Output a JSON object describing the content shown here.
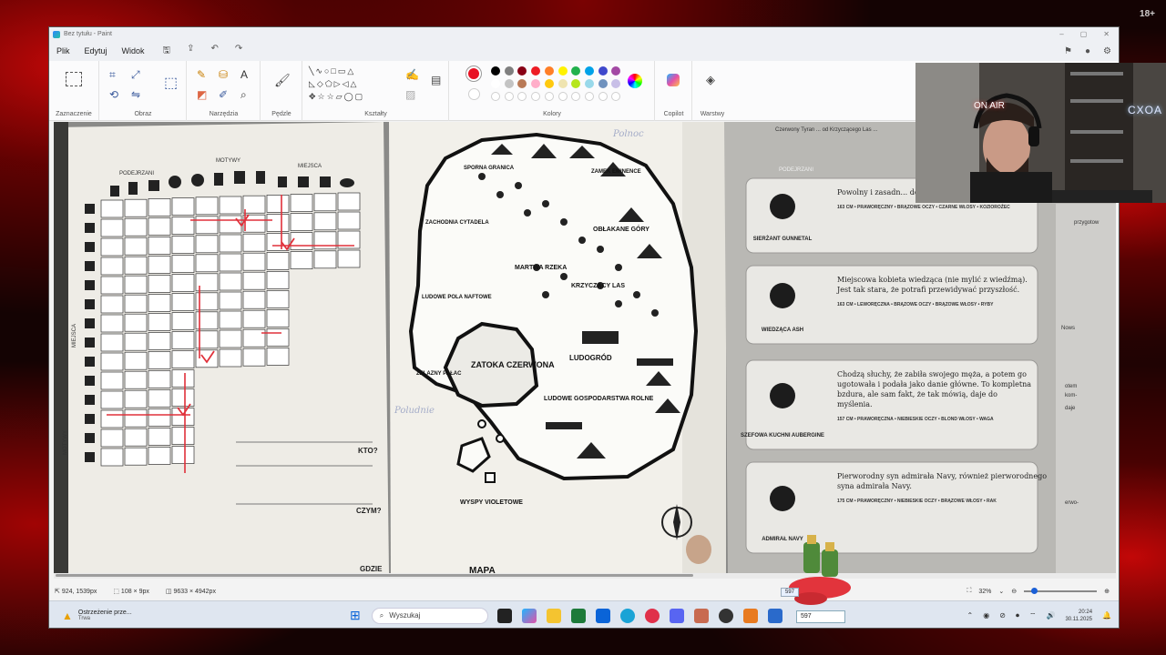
{
  "window": {
    "title": "Bez tytułu - Paint",
    "controls": [
      "–",
      "▢",
      "✕"
    ]
  },
  "menu": {
    "file": "Plik",
    "edit": "Edytuj",
    "view": "Widok"
  },
  "ribbon": {
    "groups": {
      "selection": "Zaznaczenie",
      "image": "Obraz",
      "tools": "Narzędzia",
      "brushes": "Pędzle",
      "shapes": "Kształty",
      "colors": "Kolory",
      "copilot": "Copilot",
      "layers": "Warstwy"
    },
    "palette_row1": [
      "#000000",
      "#7f7f7f",
      "#880015",
      "#ed1c24",
      "#ff7f27",
      "#fff200",
      "#22b14c",
      "#00a2e8",
      "#3f48cc",
      "#a349a4"
    ],
    "palette_row2": [
      "#ffffff",
      "#c3c3c3",
      "#b97a57",
      "#ffaec9",
      "#ffc90e",
      "#efe4b0",
      "#b5e61d",
      "#99d9ea",
      "#7092be",
      "#c8bfe7"
    ],
    "active_color": "#e81123"
  },
  "canvas": {
    "left_page": {
      "col_headers": [
        "PODEJRZANI",
        "MOTYWY",
        "MIEJSCA"
      ],
      "side_labels": [
        "MIEJSCA",
        "MOTYWY"
      ],
      "prompts": [
        "KTO?",
        "CZYM?",
        "GDZIE"
      ]
    },
    "map": {
      "handwritten_top": "Polnoc",
      "handwritten_left": "Poludnie",
      "places": [
        "SPORNA GRANICA",
        "ZAMEK EMINENCE",
        "ZACHODNIA CYTADELA",
        "OBŁAKANE GÓRY",
        "MARTWA RZEKA",
        "LUDOWE POLA NAFTOWE",
        "KRZYCZĄCY LAS",
        "ZATOKA CZERWONA",
        "LUDOGRÓD",
        "ŻELAZNY PAŁAC",
        "LUDOWE GOSPODARSTWA ROLNE",
        "WYSPY VIOLETOWE",
        "MAPA"
      ]
    },
    "right_page": {
      "top_text": "Czerwony Tyran ... od Krzyczącego Las ...",
      "section_title": "PODEJRZANI",
      "cards": [
        {
          "name": "SIERŻANT GUNNETAL",
          "desc": "Powolny i zasadn... do wiadomości show...",
          "traits": "163 CM • PRAWORĘCZNY • BRĄZOWE OCZY • CZARNE WŁOSY • KOZIOROŻEC"
        },
        {
          "name": "WIEDZĄCA ASH",
          "desc": "Miejscowa kobieta wiedząca (nie mylić z wiedźmą). Jest tak stara, że potrafi przewidywać przyszłość.",
          "traits": "163 CM • LEWORĘCZNA • BRĄZOWE OCZY • BRĄZOWE WŁOSY • RYBY"
        },
        {
          "name": "SZEFOWA KUCHNI AUBERGINE",
          "desc": "Chodzą słuchy, że zabiła swojego męża, a potem go ugotowała i podała jako danie główne. To kompletna bzdura, ale sam fakt, że tak mówią, daje do myślenia.",
          "traits": "157 CM • PRAWORĘCZNA • NIEBIESKIE OCZY • BLOND WŁOSY • WAGA"
        },
        {
          "name": "ADMIRAŁ NAVY",
          "desc": "Pierworodny syn admirała Navy, również pierworodnego syna admirała Navy.",
          "traits": "175 CM • PRAWORĘCZNY • NIEBIESKIE OCZY • BRĄZOWE WŁOSY • RAK"
        }
      ],
      "edge_words": [
        "przygotow",
        "Nows",
        "otem",
        "kom-",
        "daje",
        "erwo-"
      ]
    }
  },
  "status": {
    "cursor": "924, 1539px",
    "selection": "108 × 9px",
    "canvas_size": "9633 × 4942px",
    "zoom": "32%"
  },
  "taskbar": {
    "notice_title": "Ostrzeżenie prze...",
    "notice_sub": "Trwa",
    "search_placeholder": "Wyszukaj",
    "time": "20:24",
    "date": "30.11.2025"
  },
  "overlay": {
    "onair": "ON AIR",
    "neon_sign": "CXOA",
    "counter_badge": "597",
    "counter_input": "597",
    "stream_tag": "18+"
  }
}
